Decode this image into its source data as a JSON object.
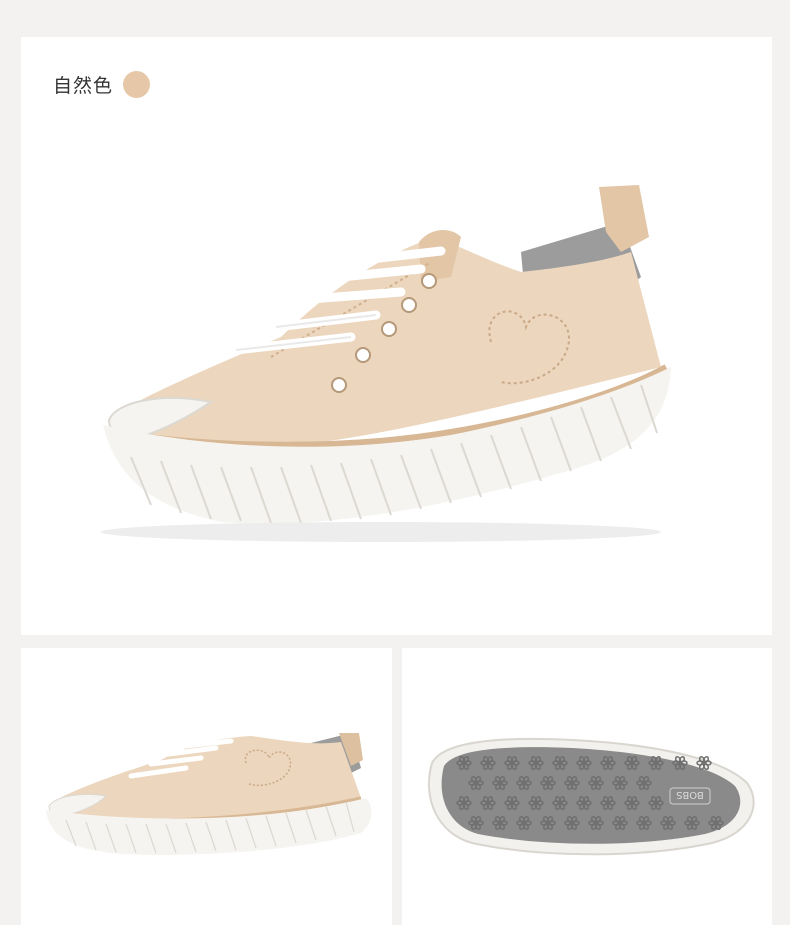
{
  "variant": {
    "color_name": "自然色",
    "swatch_color": "#e6c8a8"
  },
  "colors": {
    "canvas": "#ecd6bd",
    "canvas_shadow": "#d8bc9c",
    "sole": "#f6f4f1",
    "sole_ridge": "#dcd8d2",
    "tread": "#8a8a8a",
    "tread_dark": "#6f6f6f",
    "lace": "#ffffff",
    "lining": "#9c9c9c"
  },
  "views": {
    "main": "side-view-icon",
    "small_side": "side-view-small-icon",
    "outsole": "outsole-icon"
  }
}
